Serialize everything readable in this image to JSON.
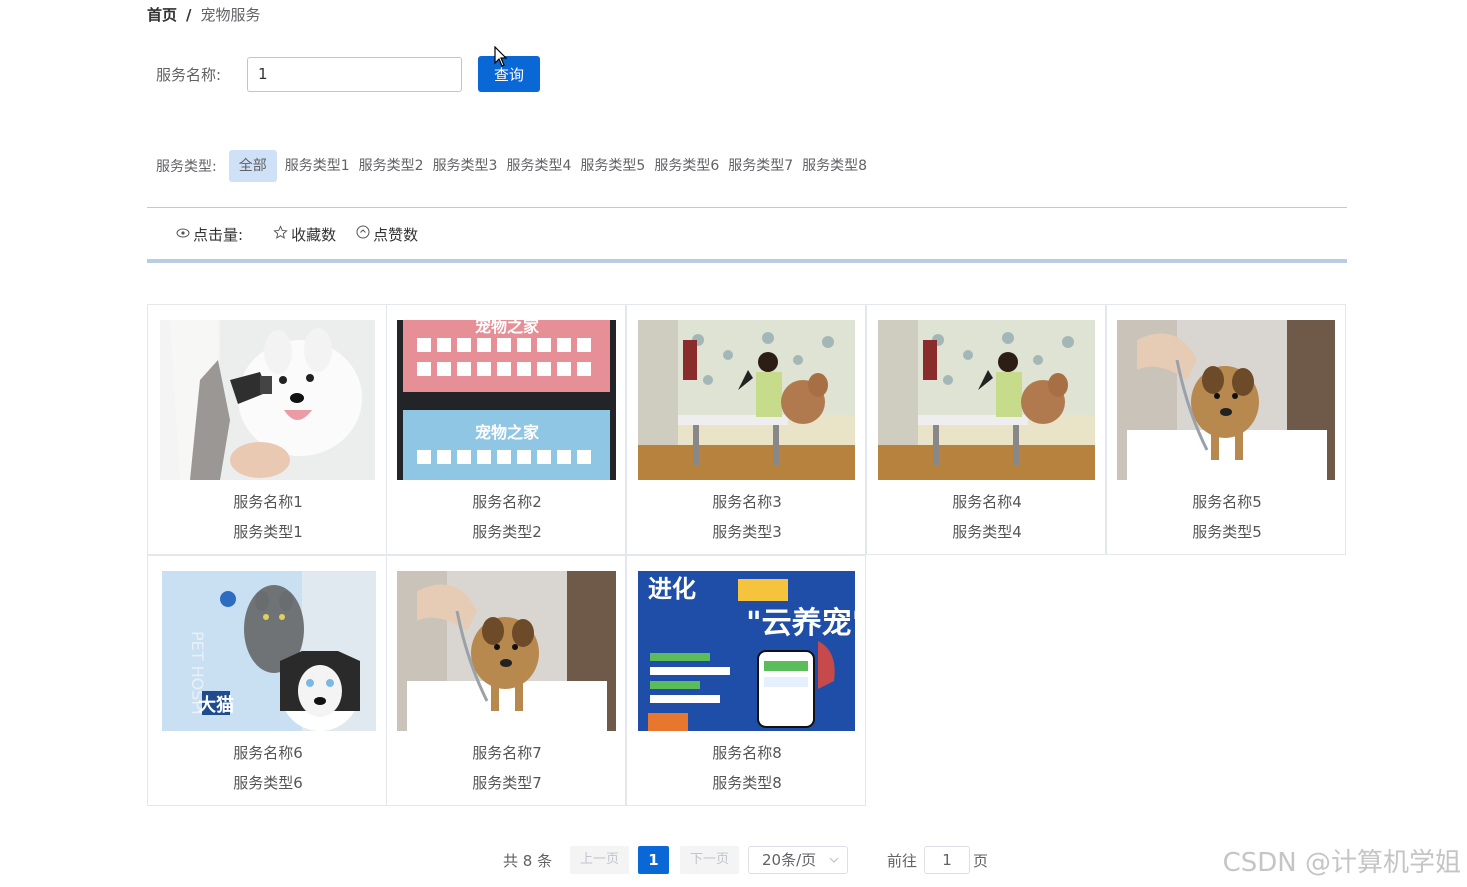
{
  "breadcrumb": {
    "home": "首页",
    "separator": "/",
    "current": "宠物服务"
  },
  "search": {
    "label": "服务名称:",
    "value": "1",
    "button": "查询"
  },
  "types": {
    "label": "服务类型:",
    "items": [
      "全部",
      "服务类型1",
      "服务类型2",
      "服务类型3",
      "服务类型4",
      "服务类型5",
      "服务类型6",
      "服务类型7",
      "服务类型8"
    ],
    "active": "全部"
  },
  "sort": [
    {
      "icon": "eye-icon",
      "label": "点击量:"
    },
    {
      "icon": "star-icon",
      "label": "收藏数"
    },
    {
      "icon": "like-icon",
      "label": "点赞数"
    }
  ],
  "cards": [
    {
      "name": "服务名称1",
      "type": "服务类型1",
      "image": "samoyed-grooming-photo"
    },
    {
      "name": "服务名称2",
      "type": "服务类型2",
      "image": "pet-home-banner"
    },
    {
      "name": "服务名称3",
      "type": "服务类型3",
      "image": "grooming-salon-photo"
    },
    {
      "name": "服务名称4",
      "type": "服务类型4",
      "image": "grooming-salon-photo"
    },
    {
      "name": "服务名称5",
      "type": "服务类型5",
      "image": "dog-bath-photo"
    },
    {
      "name": "服务名称6",
      "type": "服务类型6",
      "image": "pet-hospital-poster"
    },
    {
      "name": "服务名称7",
      "type": "服务类型7",
      "image": "dog-bath-photo"
    },
    {
      "name": "服务名称8",
      "type": "服务类型8",
      "image": "cloud-pet-poster"
    }
  ],
  "pagination": {
    "total": "共 8 条",
    "prev": "上一页",
    "current_page": "1",
    "next": "下一页",
    "page_size": "20条/页",
    "goto_prefix": "前往",
    "goto_value": "1",
    "goto_suffix": "页"
  },
  "watermark": "CSDN @计算机学姐",
  "colors": {
    "primary": "#0a67d6",
    "active_chip": "#cfe1f6",
    "divider": "#b9cde2"
  }
}
